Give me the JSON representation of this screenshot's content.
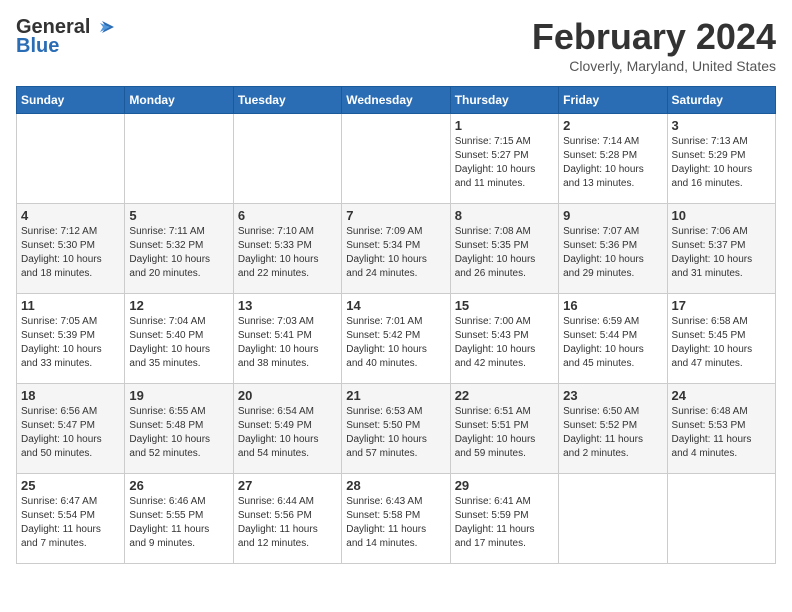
{
  "header": {
    "logo_general": "General",
    "logo_blue": "Blue",
    "month": "February 2024",
    "location": "Cloverly, Maryland, United States"
  },
  "weekdays": [
    "Sunday",
    "Monday",
    "Tuesday",
    "Wednesday",
    "Thursday",
    "Friday",
    "Saturday"
  ],
  "weeks": [
    [
      {
        "day": "",
        "info": ""
      },
      {
        "day": "",
        "info": ""
      },
      {
        "day": "",
        "info": ""
      },
      {
        "day": "",
        "info": ""
      },
      {
        "day": "1",
        "info": "Sunrise: 7:15 AM\nSunset: 5:27 PM\nDaylight: 10 hours\nand 11 minutes."
      },
      {
        "day": "2",
        "info": "Sunrise: 7:14 AM\nSunset: 5:28 PM\nDaylight: 10 hours\nand 13 minutes."
      },
      {
        "day": "3",
        "info": "Sunrise: 7:13 AM\nSunset: 5:29 PM\nDaylight: 10 hours\nand 16 minutes."
      }
    ],
    [
      {
        "day": "4",
        "info": "Sunrise: 7:12 AM\nSunset: 5:30 PM\nDaylight: 10 hours\nand 18 minutes."
      },
      {
        "day": "5",
        "info": "Sunrise: 7:11 AM\nSunset: 5:32 PM\nDaylight: 10 hours\nand 20 minutes."
      },
      {
        "day": "6",
        "info": "Sunrise: 7:10 AM\nSunset: 5:33 PM\nDaylight: 10 hours\nand 22 minutes."
      },
      {
        "day": "7",
        "info": "Sunrise: 7:09 AM\nSunset: 5:34 PM\nDaylight: 10 hours\nand 24 minutes."
      },
      {
        "day": "8",
        "info": "Sunrise: 7:08 AM\nSunset: 5:35 PM\nDaylight: 10 hours\nand 26 minutes."
      },
      {
        "day": "9",
        "info": "Sunrise: 7:07 AM\nSunset: 5:36 PM\nDaylight: 10 hours\nand 29 minutes."
      },
      {
        "day": "10",
        "info": "Sunrise: 7:06 AM\nSunset: 5:37 PM\nDaylight: 10 hours\nand 31 minutes."
      }
    ],
    [
      {
        "day": "11",
        "info": "Sunrise: 7:05 AM\nSunset: 5:39 PM\nDaylight: 10 hours\nand 33 minutes."
      },
      {
        "day": "12",
        "info": "Sunrise: 7:04 AM\nSunset: 5:40 PM\nDaylight: 10 hours\nand 35 minutes."
      },
      {
        "day": "13",
        "info": "Sunrise: 7:03 AM\nSunset: 5:41 PM\nDaylight: 10 hours\nand 38 minutes."
      },
      {
        "day": "14",
        "info": "Sunrise: 7:01 AM\nSunset: 5:42 PM\nDaylight: 10 hours\nand 40 minutes."
      },
      {
        "day": "15",
        "info": "Sunrise: 7:00 AM\nSunset: 5:43 PM\nDaylight: 10 hours\nand 42 minutes."
      },
      {
        "day": "16",
        "info": "Sunrise: 6:59 AM\nSunset: 5:44 PM\nDaylight: 10 hours\nand 45 minutes."
      },
      {
        "day": "17",
        "info": "Sunrise: 6:58 AM\nSunset: 5:45 PM\nDaylight: 10 hours\nand 47 minutes."
      }
    ],
    [
      {
        "day": "18",
        "info": "Sunrise: 6:56 AM\nSunset: 5:47 PM\nDaylight: 10 hours\nand 50 minutes."
      },
      {
        "day": "19",
        "info": "Sunrise: 6:55 AM\nSunset: 5:48 PM\nDaylight: 10 hours\nand 52 minutes."
      },
      {
        "day": "20",
        "info": "Sunrise: 6:54 AM\nSunset: 5:49 PM\nDaylight: 10 hours\nand 54 minutes."
      },
      {
        "day": "21",
        "info": "Sunrise: 6:53 AM\nSunset: 5:50 PM\nDaylight: 10 hours\nand 57 minutes."
      },
      {
        "day": "22",
        "info": "Sunrise: 6:51 AM\nSunset: 5:51 PM\nDaylight: 10 hours\nand 59 minutes."
      },
      {
        "day": "23",
        "info": "Sunrise: 6:50 AM\nSunset: 5:52 PM\nDaylight: 11 hours\nand 2 minutes."
      },
      {
        "day": "24",
        "info": "Sunrise: 6:48 AM\nSunset: 5:53 PM\nDaylight: 11 hours\nand 4 minutes."
      }
    ],
    [
      {
        "day": "25",
        "info": "Sunrise: 6:47 AM\nSunset: 5:54 PM\nDaylight: 11 hours\nand 7 minutes."
      },
      {
        "day": "26",
        "info": "Sunrise: 6:46 AM\nSunset: 5:55 PM\nDaylight: 11 hours\nand 9 minutes."
      },
      {
        "day": "27",
        "info": "Sunrise: 6:44 AM\nSunset: 5:56 PM\nDaylight: 11 hours\nand 12 minutes."
      },
      {
        "day": "28",
        "info": "Sunrise: 6:43 AM\nSunset: 5:58 PM\nDaylight: 11 hours\nand 14 minutes."
      },
      {
        "day": "29",
        "info": "Sunrise: 6:41 AM\nSunset: 5:59 PM\nDaylight: 11 hours\nand 17 minutes."
      },
      {
        "day": "",
        "info": ""
      },
      {
        "day": "",
        "info": ""
      }
    ]
  ]
}
